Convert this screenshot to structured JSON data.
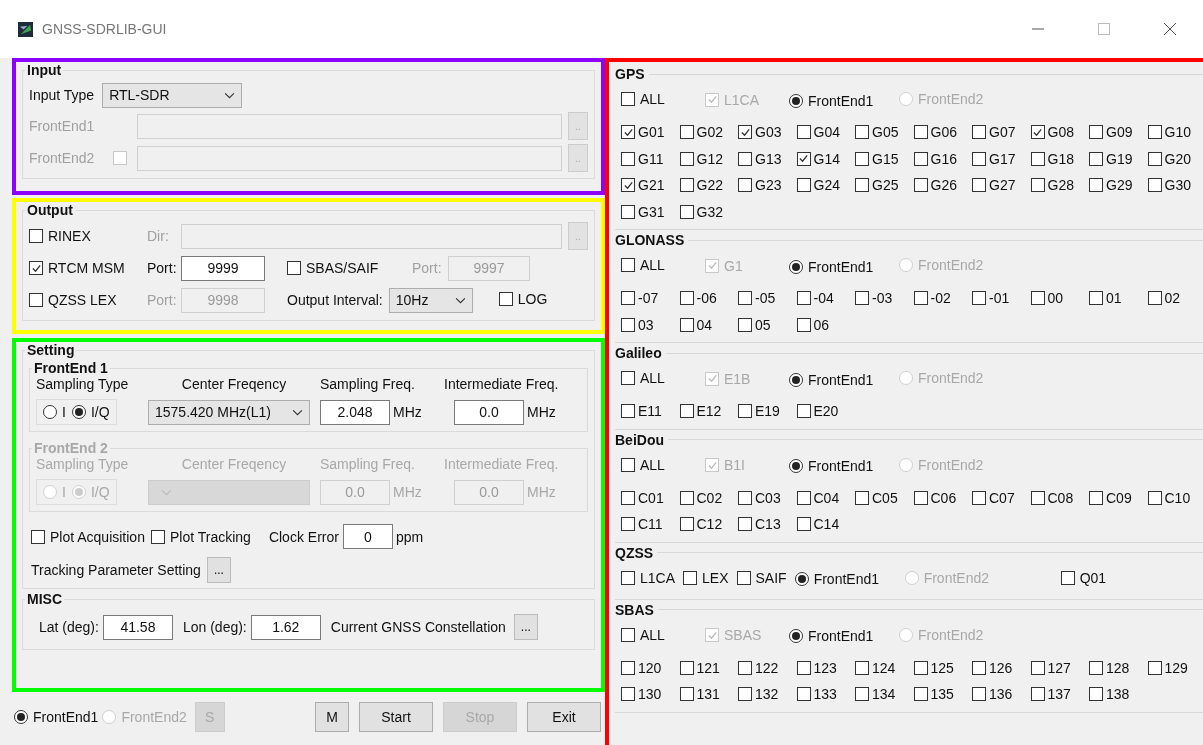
{
  "window": {
    "title": "GNSS-SDRLIB-GUI"
  },
  "input": {
    "title": "Input",
    "color": "#8c00ff",
    "type_label": "Input Type",
    "type_value": "RTL-SDR",
    "frontends": [
      {
        "label": "FrontEnd1",
        "disabled": true,
        "browse": ".."
      },
      {
        "label": "FrontEnd2",
        "disabled": true,
        "checkbox": {
          "checked": false
        },
        "browse": ".."
      }
    ]
  },
  "output": {
    "title": "Output",
    "color": "#ffff00",
    "rinex": {
      "label": "RINEX",
      "checked": false,
      "dir_label": "Dir:",
      "browse": ".."
    },
    "rtcm": {
      "label": "RTCM MSM",
      "checked": true,
      "port_label": "Port:",
      "port": "9999"
    },
    "sbas": {
      "label": "SBAS/SAIF",
      "checked": false,
      "port_label": "Port:",
      "port": "9997"
    },
    "lex": {
      "label": "QZSS LEX",
      "checked": false,
      "port_label": "Port:",
      "port": "9998"
    },
    "interval": {
      "label": "Output Interval:",
      "value": "10Hz"
    },
    "log": {
      "label": "LOG",
      "checked": false
    }
  },
  "setting": {
    "title": "Setting",
    "color": "#00ff00",
    "frontends": [
      {
        "title": "FrontEnd 1",
        "disabled": false,
        "sampling_type_label": "Sampling Type",
        "types": [
          {
            "label": "I",
            "selected": false
          },
          {
            "label": "I/Q",
            "selected": true
          }
        ],
        "center_label": "Center Freqency",
        "center_value": "1575.420 MHz(L1)",
        "sampling_label": "Sampling Freq.",
        "sampling_value": "2.048",
        "sampling_unit": "MHz",
        "if_label": "Intermediate Freq.",
        "if_value": "0.0",
        "if_unit": "MHz"
      },
      {
        "title": "FrontEnd 2",
        "disabled": true,
        "sampling_type_label": "Sampling Type",
        "types": [
          {
            "label": "I",
            "selected": false
          },
          {
            "label": "I/Q",
            "selected": true
          }
        ],
        "center_label": "Center Freqency",
        "sampling_label": "Sampling Freq.",
        "sampling_value": "0.0",
        "sampling_unit": "MHz",
        "if_label": "Intermediate Freq.",
        "if_value": "0.0",
        "if_unit": "MHz"
      }
    ],
    "plot_acquisition": {
      "label": "Plot Acquisition",
      "checked": false
    },
    "plot_tracking": {
      "label": "Plot Tracking",
      "checked": false
    },
    "clock_error": {
      "label": "Clock Error",
      "value": "0",
      "unit": "ppm"
    },
    "tracking": {
      "label": "Tracking Parameter Setting",
      "button": "..."
    },
    "misc": {
      "title": "MISC",
      "lat_label": "Lat (deg):",
      "lat": "41.58",
      "lon_label": "Lon (deg):",
      "lon": "1.62",
      "constellation_label": "Current GNSS Constellation",
      "button": "..."
    }
  },
  "bottom": {
    "frontends": [
      {
        "label": "FrontEnd1",
        "selected": true,
        "disabled": false
      },
      {
        "label": "FrontEnd2",
        "selected": false,
        "disabled": true
      }
    ],
    "select_button": {
      "label": "S",
      "disabled": true
    },
    "buttons": [
      {
        "label": "M",
        "disabled": false
      },
      {
        "label": "Start",
        "disabled": false
      },
      {
        "label": "Stop",
        "disabled": true
      },
      {
        "label": "Exit",
        "disabled": false
      }
    ]
  },
  "systems": {
    "color": "#ff0000",
    "groups": [
      {
        "name": "GPS",
        "kind": "standard",
        "signals": [
          {
            "label": "ALL",
            "checked": false,
            "disabled": false
          },
          {
            "label": "L1CA",
            "checked": true,
            "disabled": true
          }
        ],
        "frontends": [
          {
            "label": "FrontEnd1",
            "selected": true,
            "disabled": false
          },
          {
            "label": "FrontEnd2",
            "selected": false,
            "disabled": true
          }
        ],
        "satellites": [
          {
            "label": "G01",
            "checked": true
          },
          {
            "label": "G02",
            "checked": false
          },
          {
            "label": "G03",
            "checked": true
          },
          {
            "label": "G04",
            "checked": false
          },
          {
            "label": "G05",
            "checked": false
          },
          {
            "label": "G06",
            "checked": false
          },
          {
            "label": "G07",
            "checked": false
          },
          {
            "label": "G08",
            "checked": true
          },
          {
            "label": "G09",
            "checked": false
          },
          {
            "label": "G10",
            "checked": false
          },
          {
            "label": "G11",
            "checked": false
          },
          {
            "label": "G12",
            "checked": false
          },
          {
            "label": "G13",
            "checked": false
          },
          {
            "label": "G14",
            "checked": true
          },
          {
            "label": "G15",
            "checked": false
          },
          {
            "label": "G16",
            "checked": false
          },
          {
            "label": "G17",
            "checked": false
          },
          {
            "label": "G18",
            "checked": false
          },
          {
            "label": "G19",
            "checked": false
          },
          {
            "label": "G20",
            "checked": false
          },
          {
            "label": "G21",
            "checked": true
          },
          {
            "label": "G22",
            "checked": false
          },
          {
            "label": "G23",
            "checked": false
          },
          {
            "label": "G24",
            "checked": false
          },
          {
            "label": "G25",
            "checked": false
          },
          {
            "label": "G26",
            "checked": false
          },
          {
            "label": "G27",
            "checked": false
          },
          {
            "label": "G28",
            "checked": false
          },
          {
            "label": "G29",
            "checked": false
          },
          {
            "label": "G30",
            "checked": false
          },
          {
            "label": "G31",
            "checked": false
          },
          {
            "label": "G32",
            "checked": false
          }
        ]
      },
      {
        "name": "GLONASS",
        "kind": "standard",
        "signals": [
          {
            "label": "ALL",
            "checked": false,
            "disabled": false
          },
          {
            "label": "G1",
            "checked": true,
            "disabled": true
          }
        ],
        "frontends": [
          {
            "label": "FrontEnd1",
            "selected": true,
            "disabled": false
          },
          {
            "label": "FrontEnd2",
            "selected": false,
            "disabled": true
          }
        ],
        "satellites": [
          {
            "label": "-07",
            "checked": false
          },
          {
            "label": "-06",
            "checked": false
          },
          {
            "label": "-05",
            "checked": false
          },
          {
            "label": "-04",
            "checked": false
          },
          {
            "label": "-03",
            "checked": false
          },
          {
            "label": "-02",
            "checked": false
          },
          {
            "label": "-01",
            "checked": false
          },
          {
            "label": "00",
            "checked": false
          },
          {
            "label": "01",
            "checked": false
          },
          {
            "label": "02",
            "checked": false
          },
          {
            "label": "03",
            "checked": false
          },
          {
            "label": "04",
            "checked": false
          },
          {
            "label": "05",
            "checked": false
          },
          {
            "label": "06",
            "checked": false
          }
        ]
      },
      {
        "name": "Galileo",
        "kind": "standard",
        "signals": [
          {
            "label": "ALL",
            "checked": false,
            "disabled": false
          },
          {
            "label": "E1B",
            "checked": true,
            "disabled": true
          }
        ],
        "frontends": [
          {
            "label": "FrontEnd1",
            "selected": true,
            "disabled": false
          },
          {
            "label": "FrontEnd2",
            "selected": false,
            "disabled": true
          }
        ],
        "satellites": [
          {
            "label": "E11",
            "checked": false
          },
          {
            "label": "E12",
            "checked": false
          },
          {
            "label": "E19",
            "checked": false
          },
          {
            "label": "E20",
            "checked": false
          }
        ]
      },
      {
        "name": "BeiDou",
        "kind": "standard",
        "signals": [
          {
            "label": "ALL",
            "checked": false,
            "disabled": false
          },
          {
            "label": "B1I",
            "checked": true,
            "disabled": true
          }
        ],
        "frontends": [
          {
            "label": "FrontEnd1",
            "selected": true,
            "disabled": false
          },
          {
            "label": "FrontEnd2",
            "selected": false,
            "disabled": true
          }
        ],
        "satellites": [
          {
            "label": "C01",
            "checked": false
          },
          {
            "label": "C02",
            "checked": false
          },
          {
            "label": "C03",
            "checked": false
          },
          {
            "label": "C04",
            "checked": false
          },
          {
            "label": "C05",
            "checked": false
          },
          {
            "label": "C06",
            "checked": false
          },
          {
            "label": "C07",
            "checked": false
          },
          {
            "label": "C08",
            "checked": false
          },
          {
            "label": "C09",
            "checked": false
          },
          {
            "label": "C10",
            "checked": false
          },
          {
            "label": "C11",
            "checked": false
          },
          {
            "label": "C12",
            "checked": false
          },
          {
            "label": "C13",
            "checked": false
          },
          {
            "label": "C14",
            "checked": false
          }
        ]
      },
      {
        "name": "QZSS",
        "kind": "inline",
        "signals": [
          {
            "label": "L1CA",
            "checked": false,
            "disabled": false
          },
          {
            "label": "LEX",
            "checked": false,
            "disabled": false
          },
          {
            "label": "SAIF",
            "checked": false,
            "disabled": false
          }
        ],
        "frontends": [
          {
            "label": "FrontEnd1",
            "selected": true,
            "disabled": false
          },
          {
            "label": "FrontEnd2",
            "selected": false,
            "disabled": true
          }
        ],
        "satellites": [
          {
            "label": "Q01",
            "checked": false
          }
        ]
      },
      {
        "name": "SBAS",
        "kind": "standard",
        "signals": [
          {
            "label": "ALL",
            "checked": false,
            "disabled": false
          },
          {
            "label": "SBAS",
            "checked": true,
            "disabled": true
          }
        ],
        "frontends": [
          {
            "label": "FrontEnd1",
            "selected": true,
            "disabled": false
          },
          {
            "label": "FrontEnd2",
            "selected": false,
            "disabled": true
          }
        ],
        "satellites": [
          {
            "label": "120",
            "checked": false
          },
          {
            "label": "121",
            "checked": false
          },
          {
            "label": "122",
            "checked": false
          },
          {
            "label": "123",
            "checked": false
          },
          {
            "label": "124",
            "checked": false
          },
          {
            "label": "125",
            "checked": false
          },
          {
            "label": "126",
            "checked": false
          },
          {
            "label": "127",
            "checked": false
          },
          {
            "label": "128",
            "checked": false
          },
          {
            "label": "129",
            "checked": false
          },
          {
            "label": "130",
            "checked": false
          },
          {
            "label": "131",
            "checked": false
          },
          {
            "label": "132",
            "checked": false
          },
          {
            "label": "133",
            "checked": false
          },
          {
            "label": "134",
            "checked": false
          },
          {
            "label": "135",
            "checked": false
          },
          {
            "label": "136",
            "checked": false
          },
          {
            "label": "137",
            "checked": false
          },
          {
            "label": "138",
            "checked": false
          }
        ]
      }
    ]
  }
}
